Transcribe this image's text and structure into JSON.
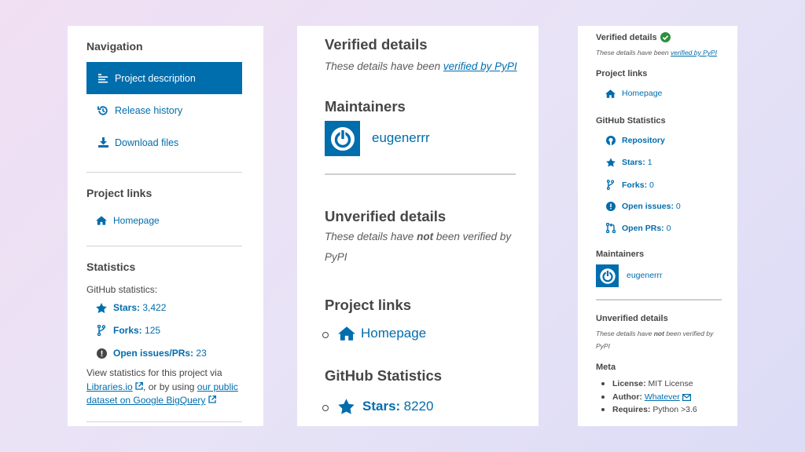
{
  "sidebar": {
    "navigation_heading": "Navigation",
    "nav_items": [
      {
        "label": "Project description",
        "icon": "align-left-icon",
        "active": true
      },
      {
        "label": "Release history",
        "icon": "history-icon"
      },
      {
        "label": "Download files",
        "icon": "download-icon"
      }
    ],
    "project_links_heading": "Project links",
    "homepage_label": "Homepage",
    "statistics_heading": "Statistics",
    "github_statistics_label": "GitHub statistics:",
    "stats": [
      {
        "key": "Stars:",
        "value": "3,422",
        "icon": "star-icon"
      },
      {
        "key": "Forks:",
        "value": "125",
        "icon": "fork-icon"
      },
      {
        "key": "Open issues/PRs:",
        "value": "23",
        "icon": "alert-circle-icon"
      }
    ],
    "view_stats_prefix": "View statistics for this project via",
    "libraries_link": "Libraries.io",
    "or_by_using": ", or by using",
    "our_public_link": "our public",
    "dataset_link": "dataset on Google BigQuery"
  },
  "middle": {
    "verified_heading": "Verified details",
    "verified_note_prefix": "These details have been",
    "verified_note_link": "verified by PyPI",
    "maintainers_heading": "Maintainers",
    "maintainer_name": "eugenerrr",
    "unverified_heading": "Unverified details",
    "unverified_note_part1": "These details have",
    "unverified_note_not": "not",
    "unverified_note_part2": "been verified by",
    "unverified_note_part3": "PyPI",
    "project_links_heading": "Project links",
    "homepage_label": "Homepage",
    "github_statistics_heading": "GitHub Statistics",
    "stars_key": "Stars:",
    "stars_value": "8220"
  },
  "right": {
    "verified_heading": "Verified details",
    "verified_note_prefix": "These details have been",
    "verified_note_link": "verified by PyPI",
    "project_links_heading": "Project links",
    "homepage_label": "Homepage",
    "github_statistics_heading": "GitHub Statistics",
    "repository_label": "Repository",
    "stats": [
      {
        "key": "Stars:",
        "value": "1",
        "icon": "star-icon"
      },
      {
        "key": "Forks:",
        "value": "0",
        "icon": "fork-icon"
      },
      {
        "key": "Open issues:",
        "value": "0",
        "icon": "alert-circle-icon"
      },
      {
        "key": "Open PRs:",
        "value": "0",
        "icon": "pull-request-icon"
      }
    ],
    "maintainers_heading": "Maintainers",
    "maintainer_name": "eugenerrr",
    "unverified_heading": "Unverified details",
    "unverified_note_part1": "These details have",
    "unverified_note_not": "not",
    "unverified_note_part2": "been verified by",
    "unverified_note_part3": "PyPI",
    "meta_heading": "Meta",
    "meta": {
      "license_key": "License:",
      "license_value": "MIT License",
      "author_key": "Author:",
      "author_value": "Whatever",
      "requires_key": "Requires:",
      "requires_value": "Python >3.6"
    }
  },
  "colors": {
    "accent": "#006dad",
    "verified_check": "#2d8f3e",
    "text": "#464646"
  }
}
